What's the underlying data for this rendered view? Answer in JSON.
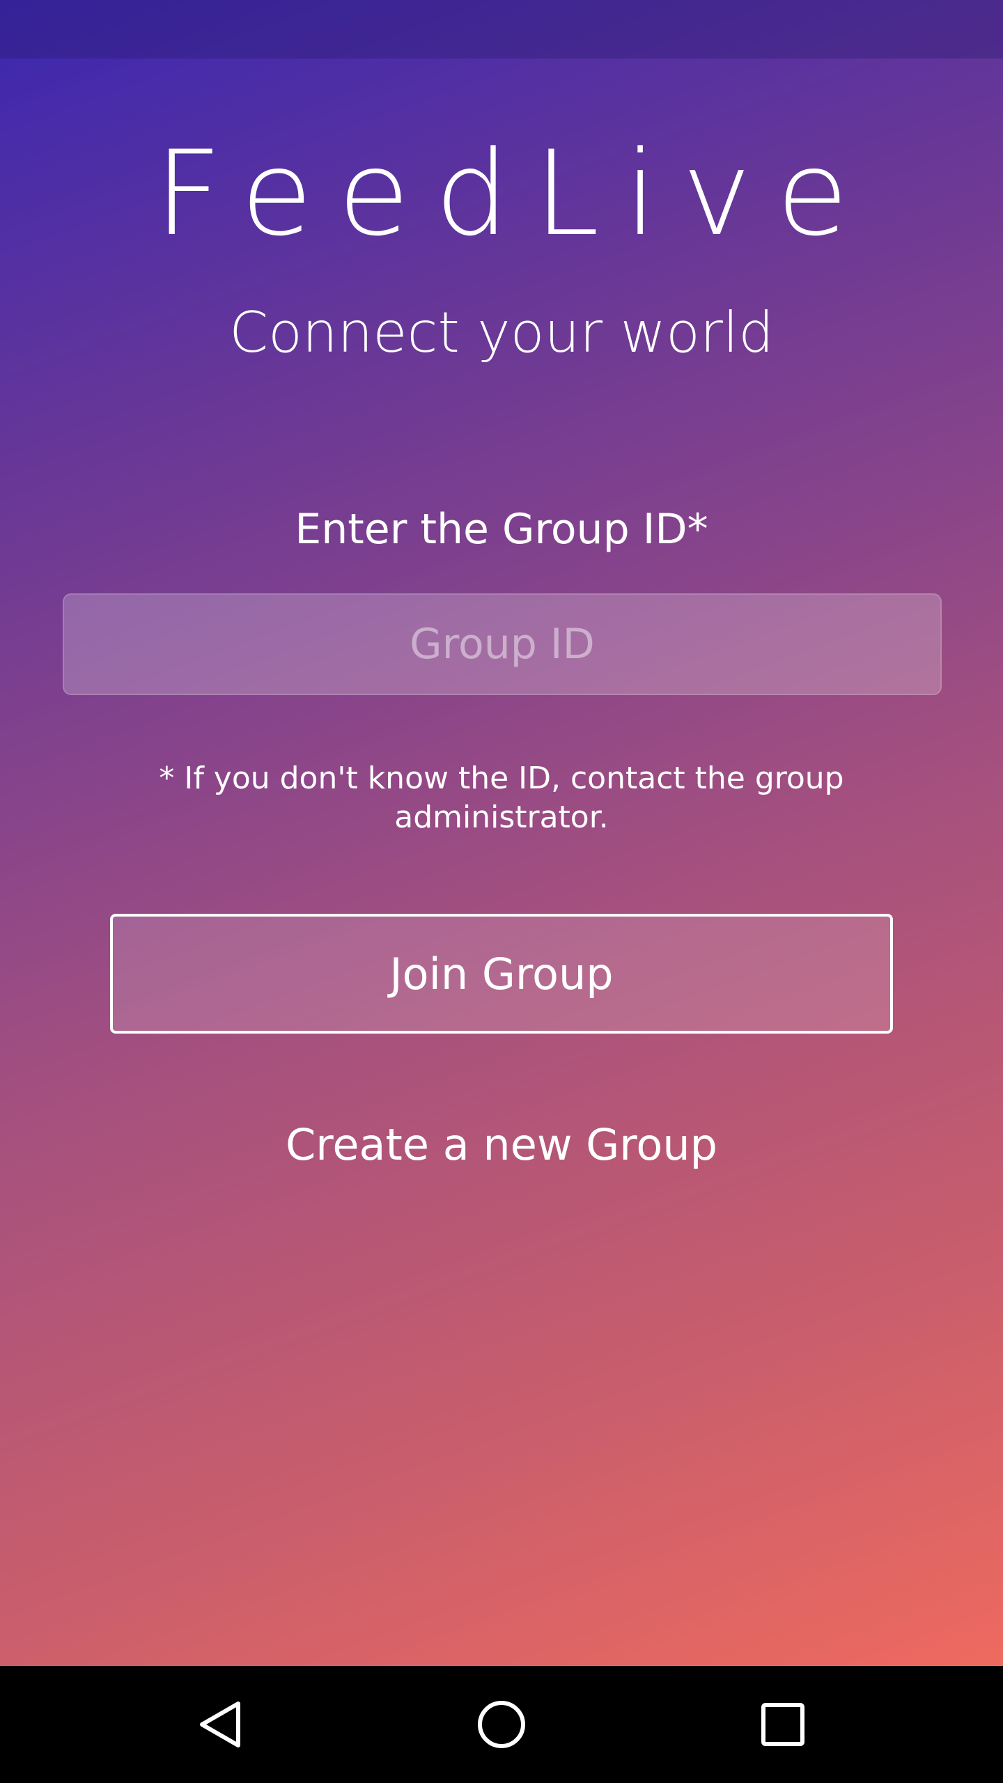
{
  "app": {
    "title": "FeedLive",
    "tagline": "Connect your world"
  },
  "form": {
    "label": "Enter the Group ID*",
    "input_value": "",
    "input_placeholder": "Group ID",
    "hint": "* If you don't know the ID, contact the group administrator."
  },
  "actions": {
    "join_label": "Join Group",
    "create_label": "Create a new Group"
  },
  "nav": {
    "back_icon": "back-triangle-icon",
    "home_icon": "home-circle-icon",
    "recent_icon": "recent-apps-square-icon"
  },
  "colors": {
    "gradient_start": "#3b27b0",
    "gradient_mid": "#a4507f",
    "gradient_end": "#ee6a5f",
    "text": "#ffffff",
    "nav_bar": "#000000"
  }
}
